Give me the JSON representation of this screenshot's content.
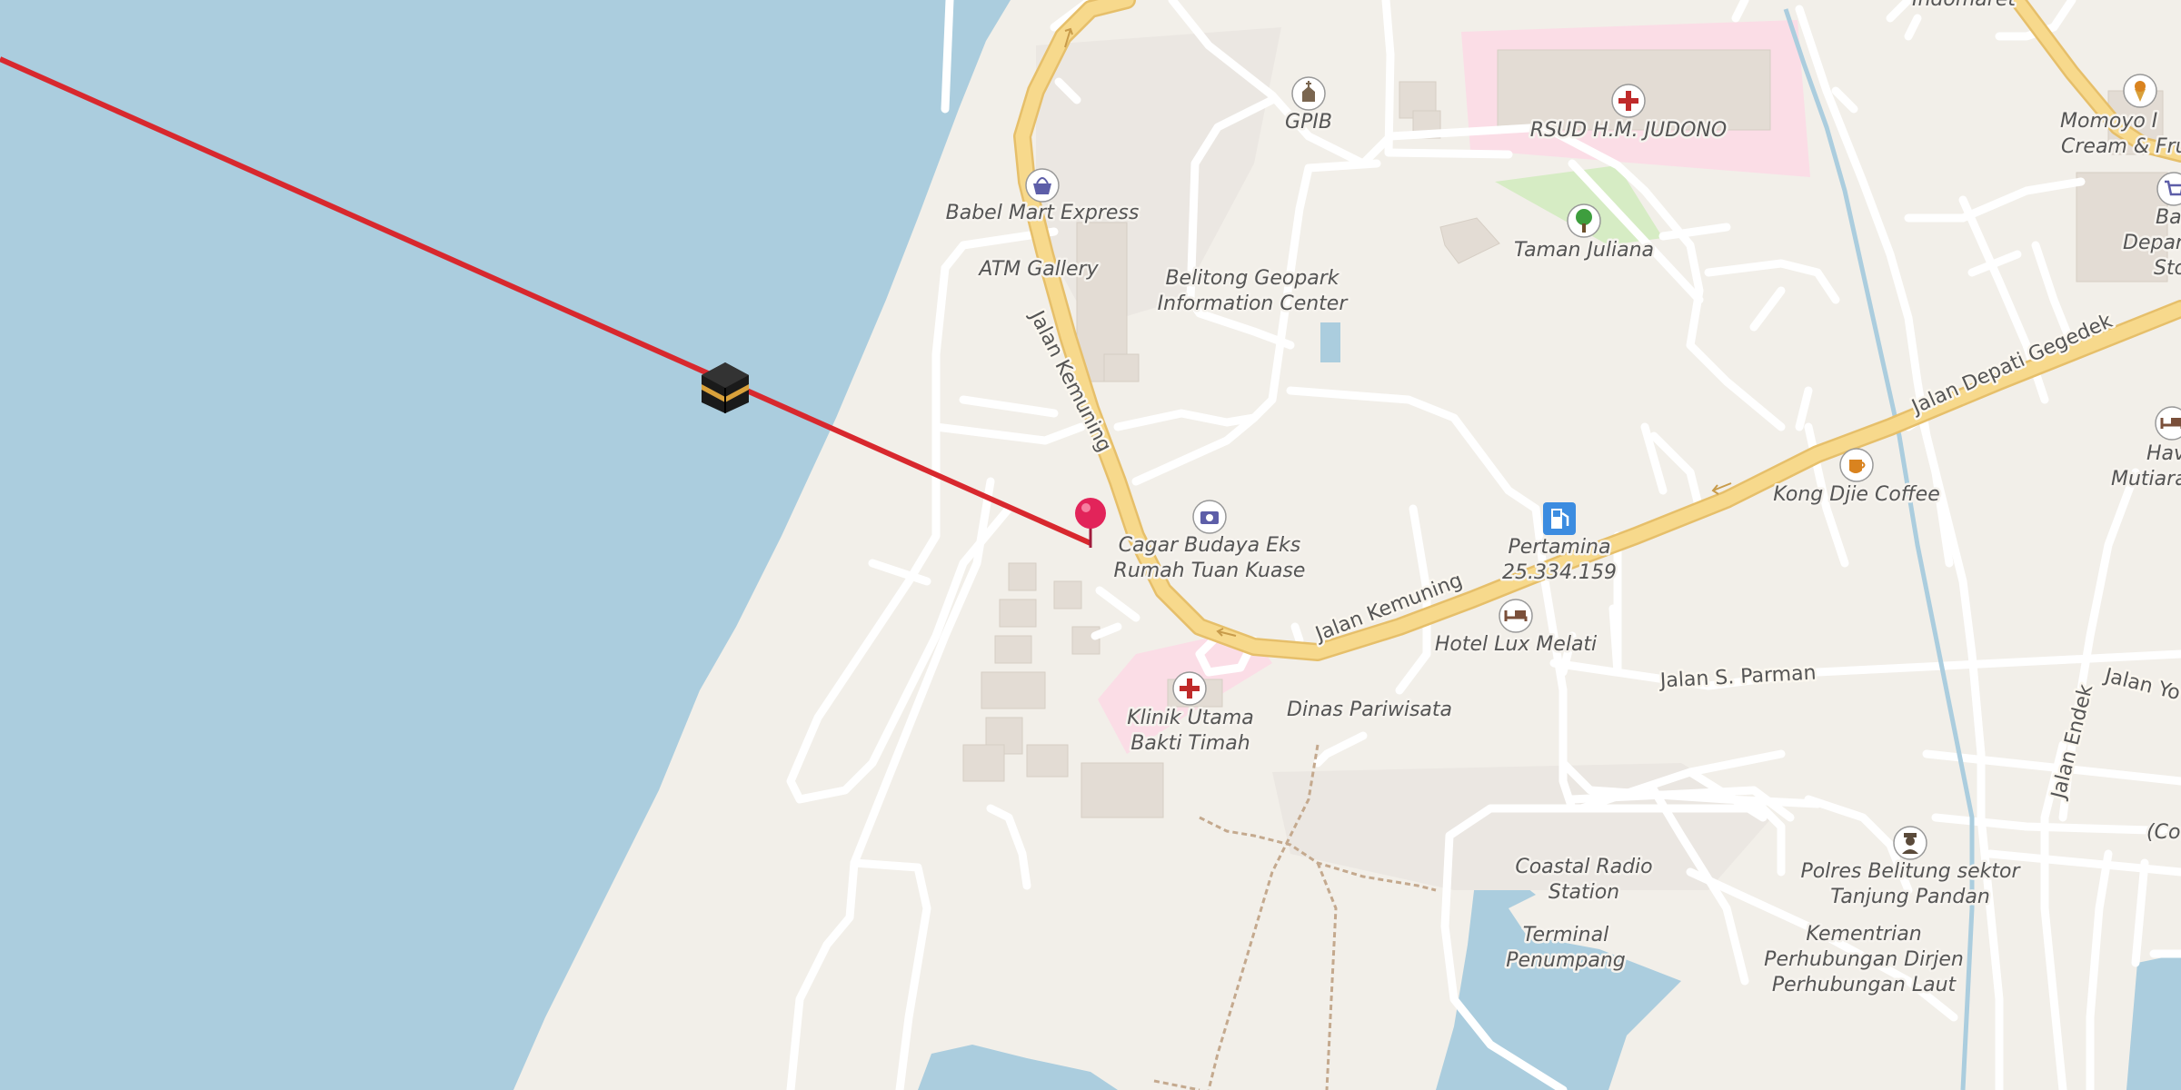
{
  "map": {
    "colors": {
      "land": "#f2efe9",
      "water": "#abcdde",
      "road_major": "#f7d98c",
      "road_major_casing": "#e6bf6a",
      "road_minor": "#ffffff",
      "building": "#e3dcd4",
      "hospital_area": "#fce8ef",
      "park": "#d6ecc4",
      "direction_line": "#d8282e",
      "marker": "#e2245a"
    },
    "poi": {
      "gpib": "GPIB",
      "rsud": "RSUD H.M. JUDONO",
      "momoyo_1": "Momoyo I",
      "momoyo_2": "Cream & Frui",
      "babel_mart": "Babel Mart Express",
      "atm_gallery": "ATM Gallery",
      "taman_juliana": "Taman Juliana",
      "bato_1": "Bat",
      "bato_2": "Depar",
      "bato_3": "Sto",
      "geopark_1": "Belitong Geopark",
      "geopark_2": "Information Center",
      "kong_djie": "Kong Djie Coffee",
      "hava_1": "Hava",
      "hava_2": "Mutiara",
      "cagar_1": "Cagar Budaya Eks",
      "cagar_2": "Rumah Tuan Kuase",
      "pertamina_1": "Pertamina",
      "pertamina_2": "25.334.159",
      "hotel_lux": "Hotel Lux Melati",
      "klinik_1": "Klinik Utama",
      "klinik_2": "Bakti Timah",
      "dinas": "Dinas Pariwisata",
      "coastal_1": "Coastal Radio",
      "coastal_2": "Station",
      "terminal_1": "Terminal",
      "terminal_2": "Penumpang",
      "polres_1": "Polres Belitung sektor",
      "polres_2": "Tanjung Pandan",
      "kementrian_1": "Kementrian",
      "kementrian_2": "Perhubungan Dirjen",
      "kementrian_3": "Perhubungan Laut",
      "col": "(Col",
      "indomaret": "Indomaret"
    },
    "roads": {
      "jalan_kemuning_1": "Jalan Kemuning",
      "jalan_kemuning_2": "Jalan Kemuning",
      "jalan_depati_gegedek": "Jalan Depati Gegedek",
      "jalan_s_parman": "Jalan S. Parman",
      "jalan_endek": "Jalan Endek",
      "jalan_yo": "Jalan Yo"
    },
    "icons": {
      "qibla": "kaaba-icon",
      "location": "location-pin-icon",
      "church": "church-icon",
      "hospital": "hospital-cross-icon",
      "shop": "shopping-basket-icon",
      "park": "tree-icon",
      "camera": "camera-icon",
      "fuel": "fuel-pump-icon",
      "hotel": "bed-icon",
      "cafe": "coffee-cup-icon",
      "police": "police-officer-icon",
      "ice_cream": "ice-cream-icon",
      "cart": "shopping-cart-icon"
    }
  }
}
